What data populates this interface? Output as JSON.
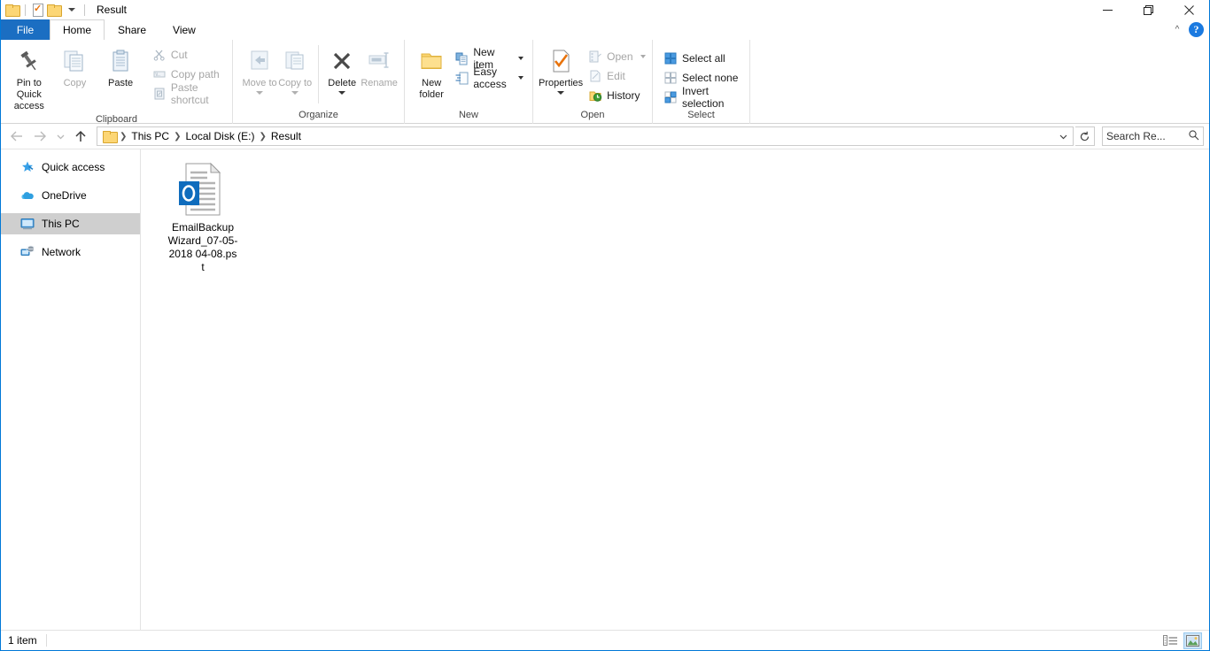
{
  "window": {
    "title": "Result",
    "quick_access": [
      "folder-icon",
      "properties-icon",
      "folder-icon"
    ],
    "controls": {
      "minimize": "minimize-icon",
      "restore": "restore-icon",
      "close": "close-icon"
    },
    "help_label": "?"
  },
  "tabs": [
    {
      "label": "File",
      "active": false,
      "file": true
    },
    {
      "label": "Home",
      "active": true
    },
    {
      "label": "Share",
      "active": false
    },
    {
      "label": "View",
      "active": false
    }
  ],
  "ribbon": {
    "groups": [
      {
        "label": "Clipboard",
        "big": [
          {
            "label": "Pin to Quick access",
            "icon": "pin-icon",
            "disabled": false
          },
          {
            "label": "Copy",
            "icon": "copy-icon",
            "disabled": true
          },
          {
            "label": "Paste",
            "icon": "paste-icon",
            "disabled": false
          }
        ],
        "small": [
          {
            "label": "Cut",
            "icon": "scissors-icon",
            "disabled": true
          },
          {
            "label": "Copy path",
            "icon": "copy-path-icon",
            "disabled": true
          },
          {
            "label": "Paste shortcut",
            "icon": "paste-shortcut-icon",
            "disabled": true
          }
        ]
      },
      {
        "label": "Organize",
        "big": [
          {
            "label": "Move to",
            "icon": "move-to-icon",
            "disabled": true,
            "dropdown": true
          },
          {
            "label": "Copy to",
            "icon": "copy-to-icon",
            "disabled": true,
            "dropdown": true
          },
          {
            "label": "Delete",
            "icon": "delete-x-icon",
            "disabled": false,
            "dropdown": true
          },
          {
            "label": "Rename",
            "icon": "rename-icon",
            "disabled": true
          }
        ]
      },
      {
        "label": "New",
        "big": [
          {
            "label": "New folder",
            "icon": "new-folder-icon",
            "disabled": false
          }
        ],
        "small": [
          {
            "label": "New item",
            "icon": "new-item-icon",
            "disabled": false,
            "dropdown": true
          },
          {
            "label": "Easy access",
            "icon": "easy-access-icon",
            "disabled": false,
            "dropdown": true
          }
        ]
      },
      {
        "label": "Open",
        "big": [
          {
            "label": "Properties",
            "icon": "properties-icon",
            "disabled": false,
            "dropdown": true
          }
        ],
        "small": [
          {
            "label": "Open",
            "icon": "open-icon",
            "disabled": true,
            "dropdown": true
          },
          {
            "label": "Edit",
            "icon": "edit-icon",
            "disabled": true
          },
          {
            "label": "History",
            "icon": "history-icon",
            "disabled": false
          }
        ]
      },
      {
        "label": "Select",
        "small": [
          {
            "label": "Select all",
            "icon": "select-all-icon",
            "disabled": false
          },
          {
            "label": "Select none",
            "icon": "select-none-icon",
            "disabled": false
          },
          {
            "label": "Invert selection",
            "icon": "invert-selection-icon",
            "disabled": false
          }
        ]
      }
    ]
  },
  "address": {
    "back": "back-arrow-icon",
    "forward": "forward-arrow-icon",
    "recent": "chevron-down-icon",
    "up": "up-arrow-icon",
    "breadcrumb": [
      "This PC",
      "Local Disk (E:)",
      "Result"
    ],
    "dropdown": "chevron-down-icon",
    "refresh": "refresh-icon"
  },
  "search": {
    "placeholder": "Search Re...",
    "icon": "search-icon"
  },
  "sidebar": {
    "items": [
      {
        "label": "Quick access",
        "icon": "star-pin-icon",
        "selected": false
      },
      {
        "label": "OneDrive",
        "icon": "cloud-icon",
        "selected": false
      },
      {
        "label": "This PC",
        "icon": "monitor-icon",
        "selected": true
      },
      {
        "label": "Network",
        "icon": "network-icon",
        "selected": false
      }
    ]
  },
  "files": [
    {
      "name": "EmailBackupWizard_07-05-2018 04-08.pst",
      "icon": "outlook-pst-icon",
      "badge": "O"
    }
  ],
  "status": {
    "item_count": "1 item",
    "views": [
      {
        "name": "details-view-button",
        "active": false
      },
      {
        "name": "large-icons-view-button",
        "active": true
      }
    ]
  },
  "colors": {
    "accent": "#1b6ec2",
    "window_border": "#0078d7",
    "selection": "#cfcfcf",
    "outlook_blue": "#0f6cbd",
    "folder_yellow": "#fcd675",
    "help_blue": "#1b7ae0"
  }
}
